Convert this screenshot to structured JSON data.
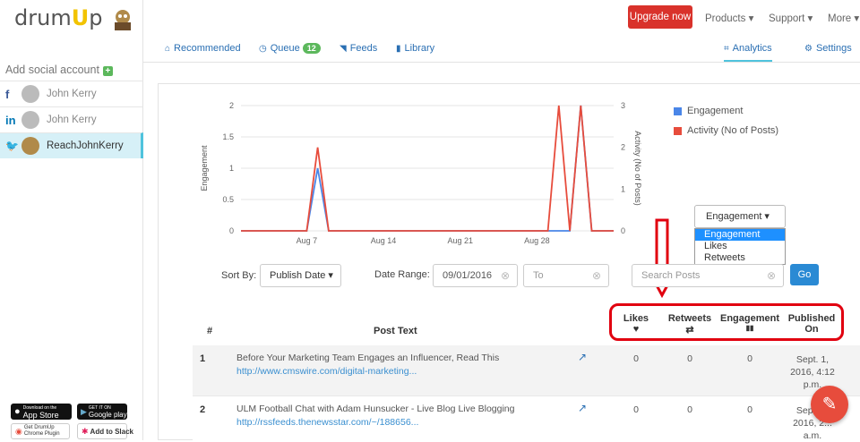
{
  "app": {
    "logo_prefix": "drum",
    "logo_u": "U",
    "logo_suffix": "p",
    "add_account": "Add social account",
    "add_plus": "+"
  },
  "accounts": [
    {
      "network": "f",
      "name": "John Kerry",
      "color": "#3b5998"
    },
    {
      "network": "in",
      "name": "John Kerry",
      "color": "#0077b5"
    },
    {
      "network": "🐦",
      "name": "ReachJohnKerry",
      "color": "#1da1f2",
      "active": true
    }
  ],
  "badges": {
    "app_store": "App Store",
    "app_store_small": "Download on the",
    "google_play": "Google play",
    "google_play_small": "GET IT ON",
    "chrome": "Get DrumUp Chrome Plugin",
    "slack": "Add to Slack"
  },
  "topbar": {
    "upgrade": "Upgrade now",
    "products": "Products ▾",
    "support": "Support ▾",
    "more": "More ▾"
  },
  "nav": {
    "recommended": "Recommended",
    "queue": "Queue",
    "queue_count": "12",
    "feeds": "Feeds",
    "library": "Library",
    "analytics": "Analytics",
    "settings": "Settings"
  },
  "chart_data": {
    "type": "line",
    "x": [
      "Aug 7",
      "Aug 14",
      "Aug 21",
      "Aug 28"
    ],
    "xlabel": "",
    "ylabel": "Engagement",
    "y2label": "Activity (No of Posts)",
    "ylim": [
      0,
      2
    ],
    "y2lim": [
      0,
      3
    ],
    "yticks": [
      "0",
      "0.5",
      "1",
      "1.5",
      "2"
    ],
    "y2ticks": [
      "0",
      "1",
      "2",
      "3"
    ],
    "series": [
      {
        "name": "Engagement",
        "color": "#4a86e8",
        "peaks": [
          {
            "date": "Aug 8",
            "value": 1
          },
          {
            "date": "Sep 1",
            "value": 2
          }
        ]
      },
      {
        "name": "Activity (No of Posts)",
        "color": "#e74c3c",
        "peaks": [
          {
            "date": "Aug 8",
            "value": 2
          },
          {
            "date": "Aug 30",
            "value": 3
          },
          {
            "date": "Sep 1",
            "value": 3
          }
        ]
      }
    ]
  },
  "dropdown": {
    "selected": "Engagement ▾",
    "options": [
      "Engagement",
      "Likes",
      "Retweets"
    ]
  },
  "filters": {
    "sort_label": "Sort By:",
    "sort_value": "Publish Date ▾",
    "date_label": "Date Range:",
    "date_from": "09/01/2016",
    "date_to_placeholder": "To",
    "search_placeholder": "Search Posts",
    "clear": "⊗",
    "go": "Go"
  },
  "table": {
    "headers": {
      "num": "#",
      "post_text": "Post Text",
      "likes": "Likes",
      "likes_icon": "♥",
      "retweets": "Retweets",
      "retweets_icon": "⇄",
      "engagement": "Engagement",
      "engagement_icon": "▮▮",
      "published": "Published",
      "published_on": "On"
    },
    "rows": [
      {
        "num": "1",
        "text": "Before Your Marketing Team Engages an Influencer, Read This",
        "link": "http://www.cmswire.com/digital-marketing...",
        "likes": "0",
        "retweets": "0",
        "engagement": "0",
        "published": "Sept. 1, 2016, 4:12 p.m."
      },
      {
        "num": "2",
        "text": "ULM Football Chat with Adam Hunsucker - Live Blog Live Blogging",
        "link": "http://rssfeeds.thenewsstar.com/~/188656...",
        "likes": "0",
        "retweets": "0",
        "engagement": "0",
        "published": "Sept. 1, 2016, 2:.. a.m."
      }
    ]
  },
  "fab": "✎"
}
